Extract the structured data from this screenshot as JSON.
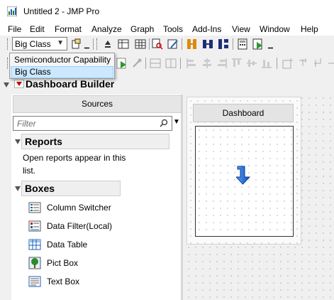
{
  "window": {
    "title": "Untitled 2 - JMP Pro"
  },
  "menu": [
    "File",
    "Edit",
    "Format",
    "Analyze",
    "Graph",
    "Tools",
    "Add-Ins",
    "View",
    "Window",
    "Help"
  ],
  "toolbar": {
    "table_combo_value": "Big Class"
  },
  "table_dropdown": {
    "options": [
      "Semiconductor Capability",
      "Big Class"
    ],
    "selected": "Big Class"
  },
  "dashboard_builder": {
    "title": "Dashboard Builder",
    "sources": {
      "header": "Sources",
      "filter_placeholder": "Filter",
      "reports": {
        "title": "Reports",
        "text": "Open reports appear in this list."
      },
      "boxes": {
        "title": "Boxes",
        "items": [
          {
            "label": "Column Switcher",
            "icon": "column-switcher-icon"
          },
          {
            "label": "Data Filter(Local)",
            "icon": "data-filter-icon"
          },
          {
            "label": "Data Table",
            "icon": "data-table-icon"
          },
          {
            "label": "Pict Box",
            "icon": "tree-picture-icon"
          },
          {
            "label": "Text Box",
            "icon": "text-box-icon"
          }
        ]
      }
    },
    "dashboard": {
      "header": "Dashboard"
    }
  },
  "colors": {
    "selection_bg": "#cce8ff",
    "drop_arrow": "#1e6fd9",
    "red_triangle": "#c00000"
  }
}
